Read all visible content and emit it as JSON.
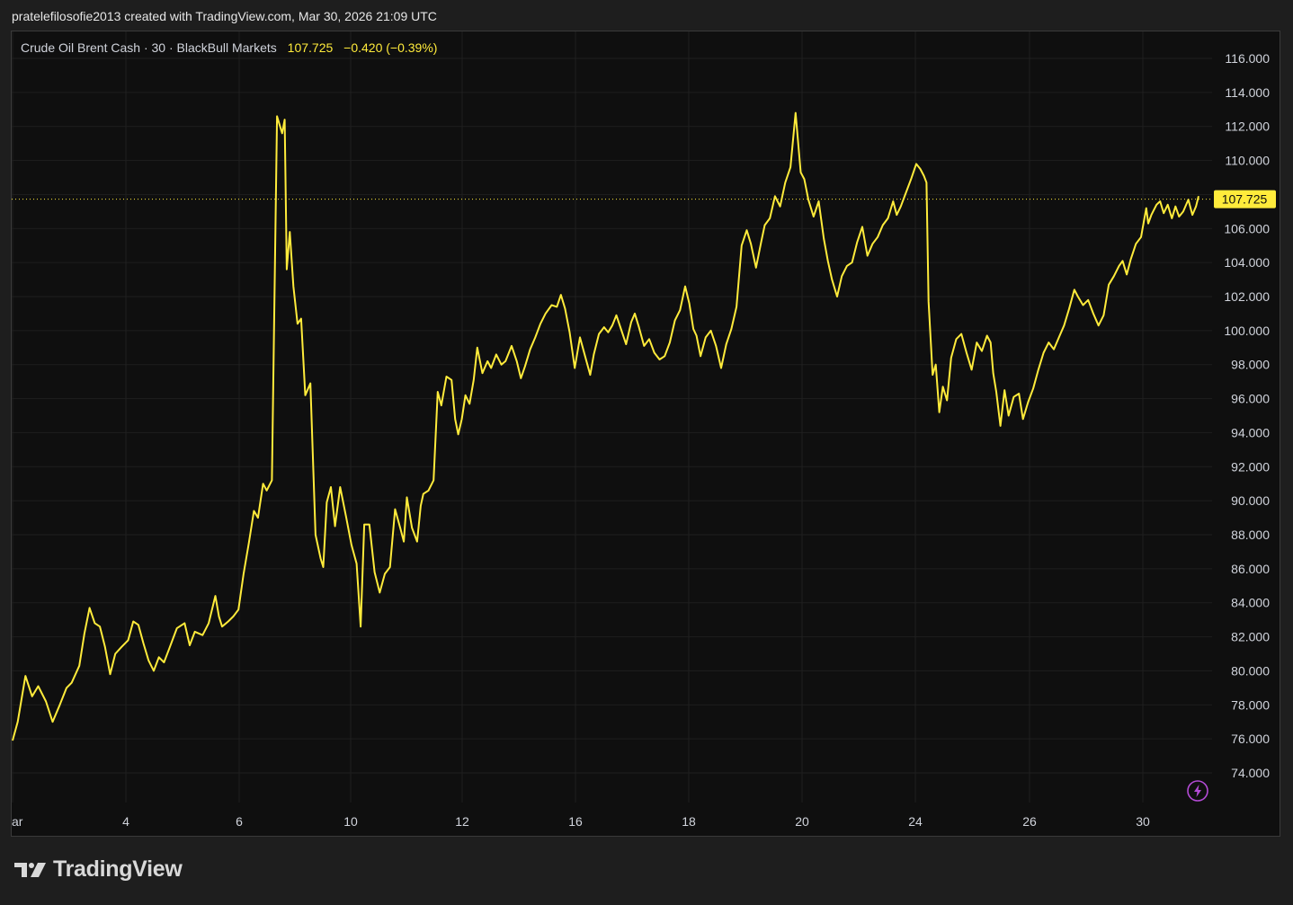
{
  "header": {
    "attribution": "pratelefilosofie2013 created with TradingView.com, Mar 30, 2026 21:09 UTC"
  },
  "legend": {
    "symbol": "Crude Oil Brent Cash · 30 · BlackBull Markets",
    "last": "107.725",
    "change": "−0.420 (−0.39%)"
  },
  "footer": {
    "logo_text": "TradingView"
  },
  "colors": {
    "background": "#0f0f0f",
    "grid": "#1f1f1f",
    "line": "#ffeb3b",
    "axis_text": "#d1d4dc",
    "price_label_bg": "#ffeb3b",
    "bolt": "#b44bd6"
  },
  "icons": {
    "bolt": "lightning-bolt-icon",
    "logo": "tradingview-logo-icon"
  },
  "chart_data": {
    "type": "line",
    "title": "Crude Oil Brent Cash · 30 · BlackBull Markets",
    "xlabel": "",
    "ylabel": "",
    "grid": true,
    "x_ticks": [
      {
        "day": 2,
        "label": "ar"
      },
      {
        "day": 4,
        "label": "4"
      },
      {
        "day": 6,
        "label": "6"
      },
      {
        "day": 10,
        "label": "10"
      },
      {
        "day": 12,
        "label": "12"
      },
      {
        "day": 16,
        "label": "16"
      },
      {
        "day": 18,
        "label": "18"
      },
      {
        "day": 20,
        "label": "20"
      },
      {
        "day": 24,
        "label": "24"
      },
      {
        "day": 26,
        "label": "26"
      },
      {
        "day": 30,
        "label": "30"
      }
    ],
    "y_ticks": [
      "116.000",
      "114.000",
      "112.000",
      "110.000",
      "108.000",
      "106.000",
      "104.000",
      "102.000",
      "100.000",
      "98.000",
      "96.000",
      "94.000",
      "92.000",
      "90.000",
      "88.000",
      "86.000",
      "84.000",
      "82.000",
      "80.000",
      "78.000",
      "76.000",
      "74.000"
    ],
    "ylim": [
      72.5,
      117.6
    ],
    "last_price": 107.725,
    "last_price_label": "107.725",
    "series": [
      {
        "x_unit": "day of March 2026 (market time)",
        "points": [
          [
            2.0,
            75.9
          ],
          [
            2.1,
            77.0
          ],
          [
            2.25,
            79.7
          ],
          [
            2.38,
            78.5
          ],
          [
            2.5,
            79.1
          ],
          [
            2.65,
            78.2
          ],
          [
            2.78,
            77.0
          ],
          [
            2.92,
            78.0
          ],
          [
            3.05,
            79.0
          ],
          [
            3.15,
            79.3
          ],
          [
            3.3,
            80.3
          ],
          [
            3.4,
            82.2
          ],
          [
            3.5,
            83.7
          ],
          [
            3.6,
            82.8
          ],
          [
            3.7,
            82.6
          ],
          [
            3.8,
            81.4
          ],
          [
            3.9,
            79.8
          ],
          [
            4.0,
            81.0
          ],
          [
            4.12,
            81.4
          ],
          [
            4.25,
            81.8
          ],
          [
            4.35,
            82.9
          ],
          [
            4.45,
            82.7
          ],
          [
            4.55,
            81.6
          ],
          [
            4.65,
            80.6
          ],
          [
            4.75,
            80.0
          ],
          [
            4.85,
            80.8
          ],
          [
            4.95,
            80.5
          ],
          [
            5.05,
            81.3
          ],
          [
            5.2,
            82.5
          ],
          [
            5.35,
            82.8
          ],
          [
            5.45,
            81.5
          ],
          [
            5.55,
            82.3
          ],
          [
            5.7,
            82.1
          ],
          [
            5.82,
            82.8
          ],
          [
            5.95,
            84.4
          ],
          [
            6.02,
            83.2
          ],
          [
            6.08,
            82.6
          ],
          [
            6.2,
            82.9
          ],
          [
            6.3,
            83.2
          ],
          [
            6.4,
            83.6
          ],
          [
            6.5,
            85.7
          ],
          [
            6.6,
            87.5
          ],
          [
            6.7,
            89.4
          ],
          [
            6.78,
            89.0
          ],
          [
            6.88,
            91.0
          ],
          [
            6.95,
            90.6
          ],
          [
            7.05,
            91.2
          ],
          [
            7.15,
            112.6
          ],
          [
            7.25,
            111.6
          ],
          [
            7.3,
            112.4
          ],
          [
            7.34,
            103.6
          ],
          [
            7.4,
            105.8
          ],
          [
            7.47,
            102.6
          ],
          [
            7.55,
            100.4
          ],
          [
            7.62,
            100.7
          ],
          [
            7.7,
            96.2
          ],
          [
            7.8,
            96.9
          ],
          [
            7.9,
            88.0
          ],
          [
            8.0,
            86.6
          ],
          [
            8.05,
            86.1
          ],
          [
            8.12,
            89.9
          ],
          [
            8.2,
            90.8
          ],
          [
            8.28,
            88.5
          ],
          [
            8.38,
            90.8
          ],
          [
            8.5,
            89.0
          ],
          [
            8.6,
            87.4
          ],
          [
            8.7,
            86.3
          ],
          [
            8.78,
            82.6
          ],
          [
            8.85,
            88.6
          ],
          [
            8.95,
            88.6
          ],
          [
            9.05,
            85.8
          ],
          [
            9.15,
            84.6
          ],
          [
            9.25,
            85.7
          ],
          [
            9.35,
            86.1
          ],
          [
            9.45,
            89.5
          ],
          [
            9.55,
            88.4
          ],
          [
            9.62,
            87.6
          ],
          [
            9.68,
            90.2
          ],
          [
            9.78,
            88.4
          ],
          [
            9.88,
            87.6
          ],
          [
            9.95,
            89.7
          ],
          [
            10.0,
            90.4
          ],
          [
            10.1,
            90.6
          ],
          [
            10.2,
            91.2
          ],
          [
            10.28,
            96.4
          ],
          [
            10.35,
            95.6
          ],
          [
            10.45,
            97.3
          ],
          [
            10.55,
            97.1
          ],
          [
            10.62,
            94.8
          ],
          [
            10.68,
            93.9
          ],
          [
            10.75,
            94.8
          ],
          [
            10.82,
            96.2
          ],
          [
            10.9,
            95.7
          ],
          [
            10.98,
            97.1
          ],
          [
            11.05,
            99.0
          ],
          [
            11.15,
            97.5
          ],
          [
            11.25,
            98.2
          ],
          [
            11.32,
            97.8
          ],
          [
            11.42,
            98.6
          ],
          [
            11.52,
            98.0
          ],
          [
            11.6,
            98.2
          ],
          [
            11.72,
            99.1
          ],
          [
            11.82,
            98.2
          ],
          [
            11.9,
            97.2
          ],
          [
            11.98,
            97.9
          ],
          [
            12.08,
            98.9
          ],
          [
            12.18,
            99.6
          ],
          [
            12.28,
            100.4
          ],
          [
            12.38,
            101.0
          ],
          [
            12.5,
            101.5
          ],
          [
            12.6,
            101.4
          ],
          [
            12.68,
            102.1
          ],
          [
            12.76,
            101.3
          ],
          [
            12.85,
            99.9
          ],
          [
            12.95,
            97.8
          ],
          [
            13.05,
            99.6
          ],
          [
            13.15,
            98.5
          ],
          [
            13.25,
            97.4
          ],
          [
            13.32,
            98.6
          ],
          [
            13.42,
            99.8
          ],
          [
            13.52,
            100.2
          ],
          [
            13.6,
            99.9
          ],
          [
            13.68,
            100.3
          ],
          [
            13.76,
            100.9
          ],
          [
            13.85,
            100.1
          ],
          [
            13.95,
            99.2
          ],
          [
            14.05,
            100.5
          ],
          [
            14.12,
            101.0
          ],
          [
            14.2,
            100.2
          ],
          [
            14.3,
            99.1
          ],
          [
            14.4,
            99.5
          ],
          [
            14.5,
            98.7
          ],
          [
            14.6,
            98.3
          ],
          [
            14.7,
            98.5
          ],
          [
            14.8,
            99.3
          ],
          [
            14.9,
            100.6
          ],
          [
            15.0,
            101.2
          ],
          [
            15.1,
            102.6
          ],
          [
            15.18,
            101.6
          ],
          [
            15.26,
            100.1
          ],
          [
            15.32,
            99.7
          ],
          [
            15.4,
            98.5
          ],
          [
            15.5,
            99.6
          ],
          [
            15.6,
            100.0
          ],
          [
            15.7,
            99.1
          ],
          [
            15.8,
            97.8
          ],
          [
            15.9,
            99.2
          ],
          [
            16.0,
            100.1
          ],
          [
            16.1,
            101.4
          ],
          [
            16.2,
            105.0
          ],
          [
            16.3,
            105.9
          ],
          [
            16.38,
            105.1
          ],
          [
            16.48,
            103.7
          ],
          [
            16.58,
            105.2
          ],
          [
            16.65,
            106.2
          ],
          [
            16.75,
            106.6
          ],
          [
            16.85,
            107.9
          ],
          [
            16.95,
            107.3
          ],
          [
            17.05,
            108.7
          ],
          [
            17.15,
            109.6
          ],
          [
            17.25,
            112.8
          ],
          [
            17.35,
            109.3
          ],
          [
            17.42,
            108.9
          ],
          [
            17.5,
            107.7
          ],
          [
            17.6,
            106.7
          ],
          [
            17.7,
            107.6
          ],
          [
            17.8,
            105.4
          ],
          [
            17.88,
            104.1
          ],
          [
            17.96,
            103.0
          ],
          [
            18.06,
            102.0
          ],
          [
            18.15,
            103.2
          ],
          [
            18.25,
            103.8
          ],
          [
            18.35,
            104.0
          ],
          [
            18.45,
            105.2
          ],
          [
            18.55,
            106.1
          ],
          [
            18.65,
            104.4
          ],
          [
            18.75,
            105.1
          ],
          [
            18.85,
            105.5
          ],
          [
            18.95,
            106.2
          ],
          [
            19.05,
            106.6
          ],
          [
            19.15,
            107.6
          ],
          [
            19.22,
            106.8
          ],
          [
            19.3,
            107.3
          ],
          [
            19.4,
            108.1
          ],
          [
            19.5,
            108.9
          ],
          [
            19.6,
            109.8
          ],
          [
            19.68,
            109.5
          ],
          [
            19.75,
            109.1
          ],
          [
            19.8,
            108.7
          ],
          [
            19.84,
            101.7
          ],
          [
            19.88,
            99.6
          ],
          [
            19.92,
            97.4
          ],
          [
            19.98,
            98.0
          ],
          [
            20.05,
            95.2
          ],
          [
            20.12,
            96.7
          ],
          [
            20.2,
            95.9
          ],
          [
            20.28,
            98.4
          ],
          [
            20.38,
            99.5
          ],
          [
            20.48,
            99.8
          ],
          [
            20.58,
            98.7
          ],
          [
            20.68,
            97.7
          ],
          [
            20.78,
            99.3
          ],
          [
            20.88,
            98.8
          ],
          [
            20.98,
            99.7
          ],
          [
            21.05,
            99.3
          ],
          [
            21.1,
            97.5
          ],
          [
            21.16,
            96.4
          ],
          [
            21.24,
            94.4
          ],
          [
            21.32,
            96.5
          ],
          [
            21.4,
            95.0
          ],
          [
            21.5,
            96.1
          ],
          [
            21.6,
            96.3
          ],
          [
            21.68,
            94.8
          ],
          [
            21.78,
            95.8
          ],
          [
            21.88,
            96.6
          ],
          [
            21.98,
            97.7
          ],
          [
            22.08,
            98.7
          ],
          [
            22.18,
            99.3
          ],
          [
            22.28,
            98.9
          ],
          [
            22.38,
            99.6
          ],
          [
            22.48,
            100.3
          ],
          [
            22.58,
            101.3
          ],
          [
            22.68,
            102.4
          ],
          [
            22.75,
            102.0
          ],
          [
            22.85,
            101.5
          ],
          [
            22.95,
            101.8
          ],
          [
            23.05,
            101.0
          ],
          [
            23.15,
            100.3
          ],
          [
            23.25,
            100.9
          ],
          [
            23.35,
            102.7
          ],
          [
            23.45,
            103.2
          ],
          [
            23.55,
            103.8
          ],
          [
            23.62,
            104.1
          ],
          [
            23.7,
            103.3
          ],
          [
            23.78,
            104.2
          ],
          [
            23.88,
            105.1
          ],
          [
            23.98,
            105.5
          ],
          [
            24.08,
            107.2
          ],
          [
            24.12,
            106.3
          ],
          [
            24.18,
            106.8
          ],
          [
            24.28,
            107.4
          ],
          [
            24.35,
            107.6
          ],
          [
            24.42,
            106.9
          ],
          [
            24.5,
            107.4
          ],
          [
            24.58,
            106.6
          ],
          [
            24.65,
            107.3
          ],
          [
            24.72,
            106.7
          ],
          [
            24.8,
            107.0
          ],
          [
            24.9,
            107.7
          ],
          [
            24.98,
            106.8
          ],
          [
            25.05,
            107.3
          ],
          [
            25.1,
            107.9
          ]
        ]
      }
    ]
  }
}
